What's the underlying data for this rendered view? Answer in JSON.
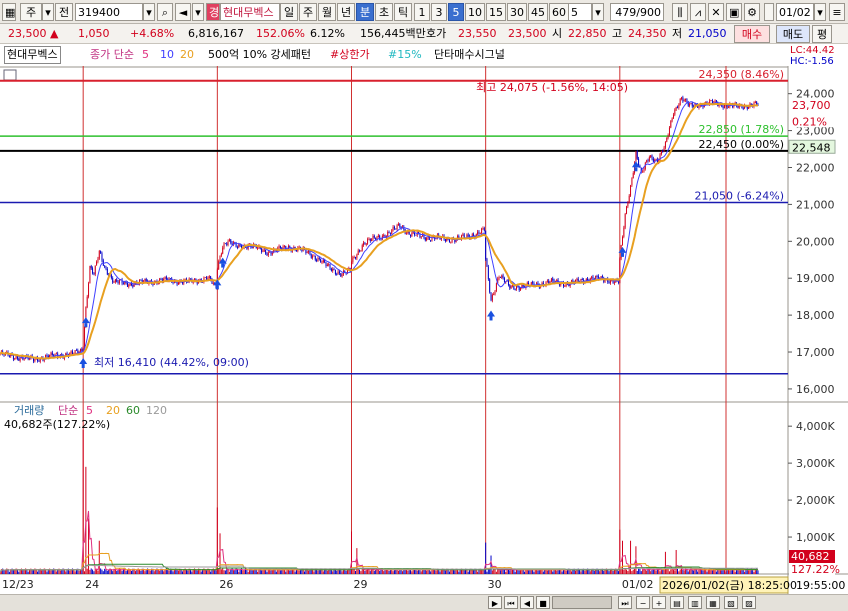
{
  "toolbar": {
    "market": "주",
    "type": "전",
    "code": "319400",
    "stock_name": "현대무벡스",
    "periods": [
      "일",
      "주",
      "월",
      "년",
      "분",
      "초",
      "틱"
    ],
    "minutes": [
      "1",
      "3",
      "5",
      "10",
      "15",
      "30",
      "45",
      "60"
    ],
    "selected_period": "분",
    "selected_minute": "5",
    "interval_value": "5",
    "count": "479/900",
    "date": "01/02"
  },
  "info": {
    "price": "23,500",
    "change": "1,050",
    "change_pct": "+4.68%",
    "volume": "6,816,167",
    "volume_ratio": "152.06%",
    "turnover": "6.12%",
    "amount": "156,445백만",
    "quote_label": "호가",
    "bid": "23,550",
    "ask": "23,500",
    "open_label": "시",
    "open": "22,850",
    "high_label": "고",
    "high": "24,350",
    "low_label": "저",
    "low": "21,050",
    "buy_label": "매수",
    "sell_label": "매도",
    "eval_label": "평"
  },
  "legend": {
    "name": "현대무벡스",
    "ma_title": "종가 단순",
    "ma_periods": [
      "5",
      "10",
      "20"
    ],
    "ind1": "500억 10% 강세패턴",
    "ind2": "#상한가",
    "ind3": "#15%",
    "ind4": "단타매수시그널",
    "lc": "LC:44.42",
    "hc": "HC:-1.56"
  },
  "colors": {
    "up": "#d2001c",
    "down": "#0000c8",
    "ma5": "#e03080",
    "ma10": "#4040ff",
    "ma20": "#e8a020",
    "ma60": "#2a8a2a",
    "ma120": "#9a9a9a",
    "level_high": "#d8202e",
    "level_green": "#2ec12e",
    "level_black": "#000000",
    "level_blue": "#1a1ab0",
    "vline": "#d03030",
    "signal": "#1a50e0"
  },
  "chart_data": {
    "type": "candlestick",
    "price_axis": {
      "ylim": [
        15700,
        24750
      ],
      "ticks": [
        16000,
        17000,
        18000,
        19000,
        20000,
        21000,
        22000,
        23000,
        24000
      ]
    },
    "price_tick_labels": [
      "16,000",
      "17,000",
      "18,000",
      "19,000",
      "20,000",
      "21,000",
      "22,000",
      "23,000",
      "24,000"
    ],
    "volume_axis": {
      "ylim": [
        0,
        4600000
      ],
      "ticks": [
        1000000,
        2000000,
        3000000,
        4000000
      ]
    },
    "volume_tick_labels": [
      "1,000K",
      "2,000K",
      "3,000K",
      "4,000K"
    ],
    "x_labels": [
      "12/23",
      "24",
      "26",
      "29",
      "30",
      "01/02"
    ],
    "x_label_index": [
      0,
      62,
      162,
      262,
      362,
      462
    ],
    "session_start_index": [
      62,
      162,
      262,
      362,
      462
    ],
    "series_close": [
      {
        "i": 0,
        "v": 16950
      },
      {
        "i": 10,
        "v": 16880
      },
      {
        "i": 25,
        "v": 16800
      },
      {
        "i": 40,
        "v": 16900
      },
      {
        "i": 55,
        "v": 16950
      },
      {
        "i": 61,
        "v": 17050
      },
      {
        "i": 62,
        "v": 17200
      },
      {
        "i": 64,
        "v": 18200
      },
      {
        "i": 67,
        "v": 19300
      },
      {
        "i": 70,
        "v": 19100
      },
      {
        "i": 74,
        "v": 19700
      },
      {
        "i": 78,
        "v": 19300
      },
      {
        "i": 85,
        "v": 18900
      },
      {
        "i": 95,
        "v": 18850
      },
      {
        "i": 110,
        "v": 18900
      },
      {
        "i": 125,
        "v": 18950
      },
      {
        "i": 140,
        "v": 18900
      },
      {
        "i": 155,
        "v": 19000
      },
      {
        "i": 161,
        "v": 18750
      },
      {
        "i": 162,
        "v": 19300
      },
      {
        "i": 166,
        "v": 19900
      },
      {
        "i": 170,
        "v": 20000
      },
      {
        "i": 176,
        "v": 19850
      },
      {
        "i": 185,
        "v": 19900
      },
      {
        "i": 200,
        "v": 19700
      },
      {
        "i": 215,
        "v": 19850
      },
      {
        "i": 230,
        "v": 19700
      },
      {
        "i": 245,
        "v": 19300
      },
      {
        "i": 255,
        "v": 19100
      },
      {
        "i": 261,
        "v": 19200
      },
      {
        "i": 262,
        "v": 19450
      },
      {
        "i": 270,
        "v": 19900
      },
      {
        "i": 280,
        "v": 20100
      },
      {
        "i": 290,
        "v": 20200
      },
      {
        "i": 298,
        "v": 20450
      },
      {
        "i": 305,
        "v": 20200
      },
      {
        "i": 320,
        "v": 20100
      },
      {
        "i": 340,
        "v": 20050
      },
      {
        "i": 355,
        "v": 20200
      },
      {
        "i": 361,
        "v": 20300
      },
      {
        "i": 362,
        "v": 19500
      },
      {
        "i": 366,
        "v": 18400
      },
      {
        "i": 372,
        "v": 19100
      },
      {
        "i": 380,
        "v": 18750
      },
      {
        "i": 395,
        "v": 18800
      },
      {
        "i": 410,
        "v": 18900
      },
      {
        "i": 425,
        "v": 18850
      },
      {
        "i": 440,
        "v": 19000
      },
      {
        "i": 455,
        "v": 18950
      },
      {
        "i": 461,
        "v": 18900
      },
      {
        "i": 462,
        "v": 19500
      },
      {
        "i": 466,
        "v": 20700
      },
      {
        "i": 470,
        "v": 21500
      },
      {
        "i": 474,
        "v": 22400
      },
      {
        "i": 478,
        "v": 21800
      },
      {
        "i": 484,
        "v": 22300
      },
      {
        "i": 490,
        "v": 22200
      },
      {
        "i": 496,
        "v": 22600
      },
      {
        "i": 502,
        "v": 23500
      },
      {
        "i": 508,
        "v": 23900
      },
      {
        "i": 514,
        "v": 23650
      },
      {
        "i": 520,
        "v": 23700
      },
      {
        "i": 530,
        "v": 23750
      },
      {
        "i": 540,
        "v": 23700
      },
      {
        "i": 550,
        "v": 23650
      },
      {
        "i": 560,
        "v": 23700
      },
      {
        "i": 565,
        "v": 23700
      }
    ],
    "volume_peaks": [
      {
        "i": 62,
        "v": 3900000
      },
      {
        "i": 64,
        "v": 2900000
      },
      {
        "i": 66,
        "v": 1500000
      },
      {
        "i": 74,
        "v": 900000
      },
      {
        "i": 162,
        "v": 1800000
      },
      {
        "i": 164,
        "v": 1100000
      },
      {
        "i": 262,
        "v": 1150000
      },
      {
        "i": 266,
        "v": 700000
      },
      {
        "i": 362,
        "v": 850000
      },
      {
        "i": 366,
        "v": 500000
      },
      {
        "i": 462,
        "v": 1200000
      },
      {
        "i": 464,
        "v": 900000
      },
      {
        "i": 470,
        "v": 900000
      },
      {
        "i": 474,
        "v": 750000
      },
      {
        "i": 496,
        "v": 600000
      },
      {
        "i": 504,
        "v": 650000
      }
    ],
    "levels": [
      {
        "value": 24350,
        "label": "24,350 (8.46%)",
        "color": "#d8202e"
      },
      {
        "value": 22850,
        "label": "22,850 (1.78%)",
        "color": "#2ec12e"
      },
      {
        "value": 22450,
        "label": "22,450 (0.00%)",
        "color": "#000000"
      },
      {
        "value": 21050,
        "label": "21,050 (-6.24%)",
        "color": "#1a1ab0"
      },
      {
        "value": 16410,
        "label": "",
        "color": "#1a1ab0"
      }
    ],
    "annotations": {
      "high": "최고 24,075 (-1.56%, 14:05)",
      "low": "최저 16,410 (44.42%, 09:00)"
    },
    "signal_arrows": [
      62,
      64,
      162,
      166,
      366,
      464,
      474
    ],
    "price_badges": [
      {
        "text": "23,700",
        "value": 23700,
        "color": "#d2001c",
        "bg": "#fff"
      },
      {
        "text": "0.21%",
        "value": 23250,
        "color": "#d2001c",
        "bg": "#fff"
      },
      {
        "text": "22,548",
        "value": 22548,
        "color": "#000",
        "bg": "#e4f7df"
      }
    ],
    "volume_legend": {
      "title": "거래량",
      "ma": "단순",
      "periods": [
        "5",
        "20",
        "60",
        "120"
      ],
      "value": "40,682주(127.22%)"
    },
    "volume_badges": [
      {
        "text": "40,682",
        "color": "#fff",
        "bg": "#d2001c"
      },
      {
        "text": "127.22%",
        "color": "#d2001c",
        "bg": "#fff"
      }
    ],
    "footer_date": "2026/01/02(금) 18:25:00",
    "footer_time": "19:55:00"
  }
}
